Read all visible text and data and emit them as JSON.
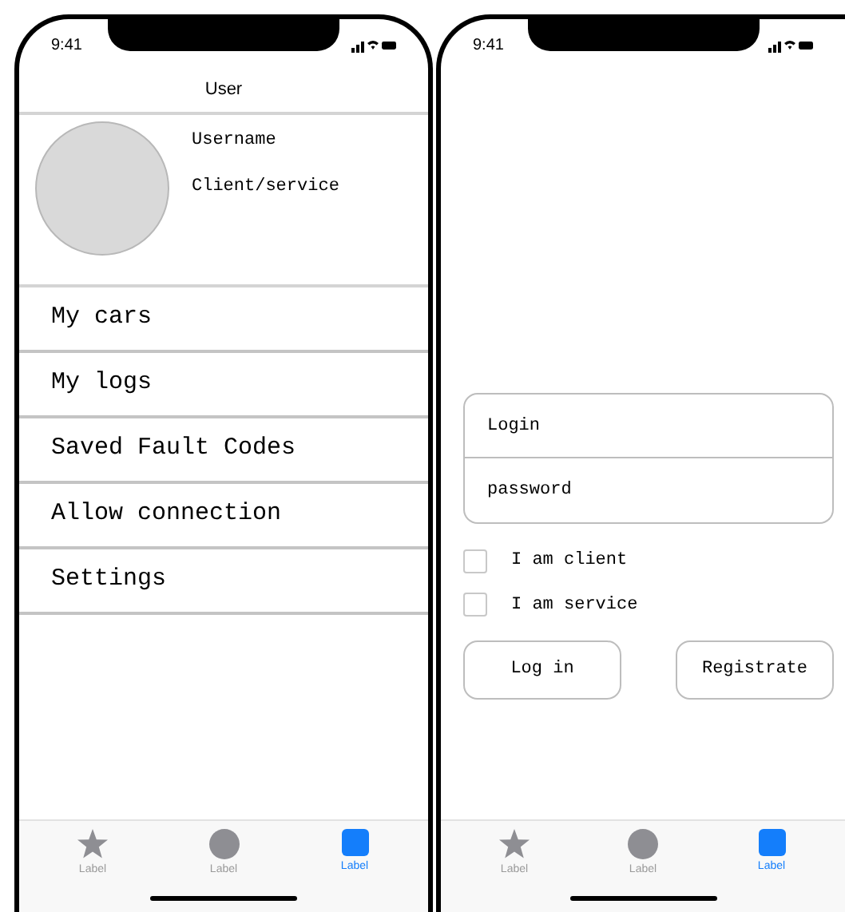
{
  "profile_screen": {
    "status_time": "9:41",
    "title": "User",
    "profile": {
      "name": "Username",
      "role": "Client/service"
    },
    "menu": [
      "My cars",
      "My logs",
      "Saved Fault Codes",
      "Allow connection",
      "Settings"
    ],
    "tabs": [
      {
        "kind": "star",
        "label": "Label",
        "selected": false
      },
      {
        "kind": "circle",
        "label": "Label",
        "selected": false
      },
      {
        "kind": "square",
        "label": "Label",
        "selected": true
      }
    ]
  },
  "login_screen": {
    "status_time": "9:41",
    "login": {
      "placeholder": "Login"
    },
    "password": {
      "placeholder": "password"
    },
    "checkboxes": [
      {
        "label": "I am client",
        "checked": false
      },
      {
        "label": "I am service",
        "checked": false
      }
    ],
    "buttons": [
      "Log in",
      "Registrate"
    ],
    "tabs": [
      {
        "kind": "star",
        "label": "Label",
        "selected": false
      },
      {
        "kind": "circle",
        "label": "Label",
        "selected": false
      },
      {
        "kind": "square",
        "label": "Label",
        "selected": true
      }
    ]
  }
}
